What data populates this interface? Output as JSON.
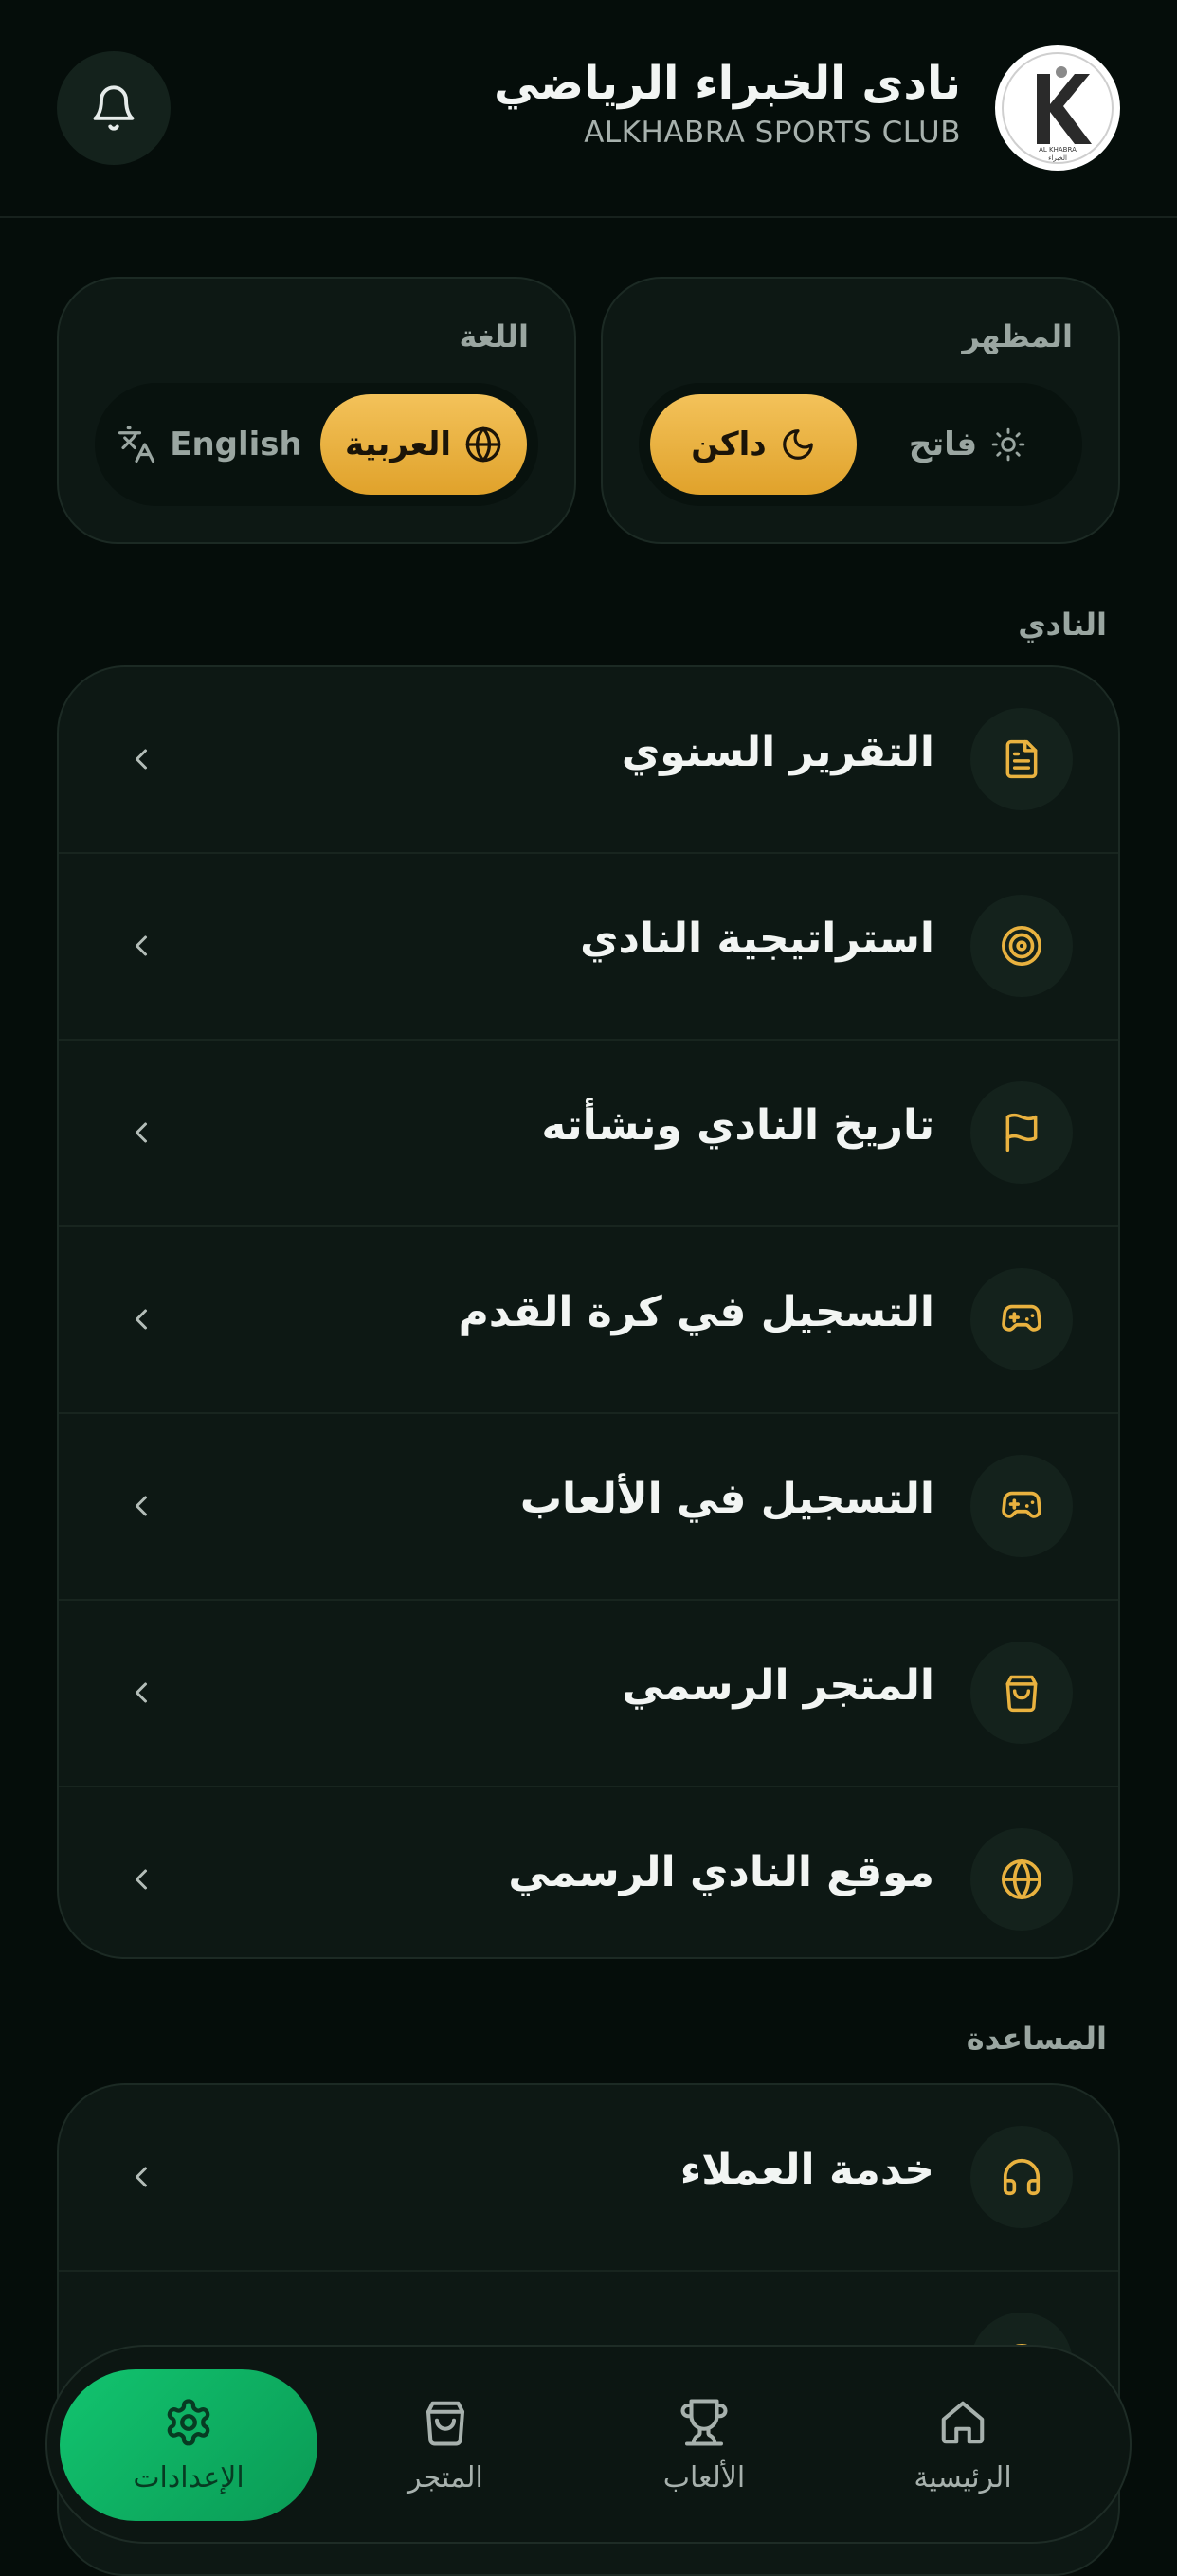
{
  "header": {
    "club_name": "نادى الخبراء الرياضي",
    "club_subtitle": "ALKHABRA SPORTS CLUB",
    "logo_text": "AL KHABRA",
    "logo_text_ar": "الخبراء"
  },
  "appearance": {
    "title": "المظهر",
    "light_label": "فاتح",
    "dark_label": "داكن",
    "selected": "dark"
  },
  "language": {
    "title": "اللغة",
    "arabic_label": "العربية",
    "english_label": "English",
    "selected": "arabic"
  },
  "club_section": {
    "label": "النادي",
    "items": [
      {
        "label": "التقرير السنوي",
        "icon": "document-icon"
      },
      {
        "label": "استراتيجية النادي",
        "icon": "target-icon"
      },
      {
        "label": "تاريخ النادي ونشأته",
        "icon": "flag-icon"
      },
      {
        "label": "التسجيل في كرة القدم",
        "icon": "gamepad-icon"
      },
      {
        "label": "التسجيل في الألعاب",
        "icon": "gamepad-icon"
      },
      {
        "label": "المتجر الرسمي",
        "icon": "shopping-bag-icon"
      },
      {
        "label": "موقع النادي الرسمي",
        "icon": "globe-icon"
      }
    ]
  },
  "help_section": {
    "label": "المساعدة",
    "items": [
      {
        "label": "خدمة العملاء",
        "icon": "headphones-icon"
      }
    ]
  },
  "bottom_nav": {
    "home": "الرئيسية",
    "games": "الألعاب",
    "store": "المتجر",
    "settings": "الإعدادات",
    "active": "settings"
  },
  "colors": {
    "accent_gold": "#e9b23f",
    "accent_green": "#0fb563",
    "background": "#050d0a",
    "card": "#0d1814"
  }
}
